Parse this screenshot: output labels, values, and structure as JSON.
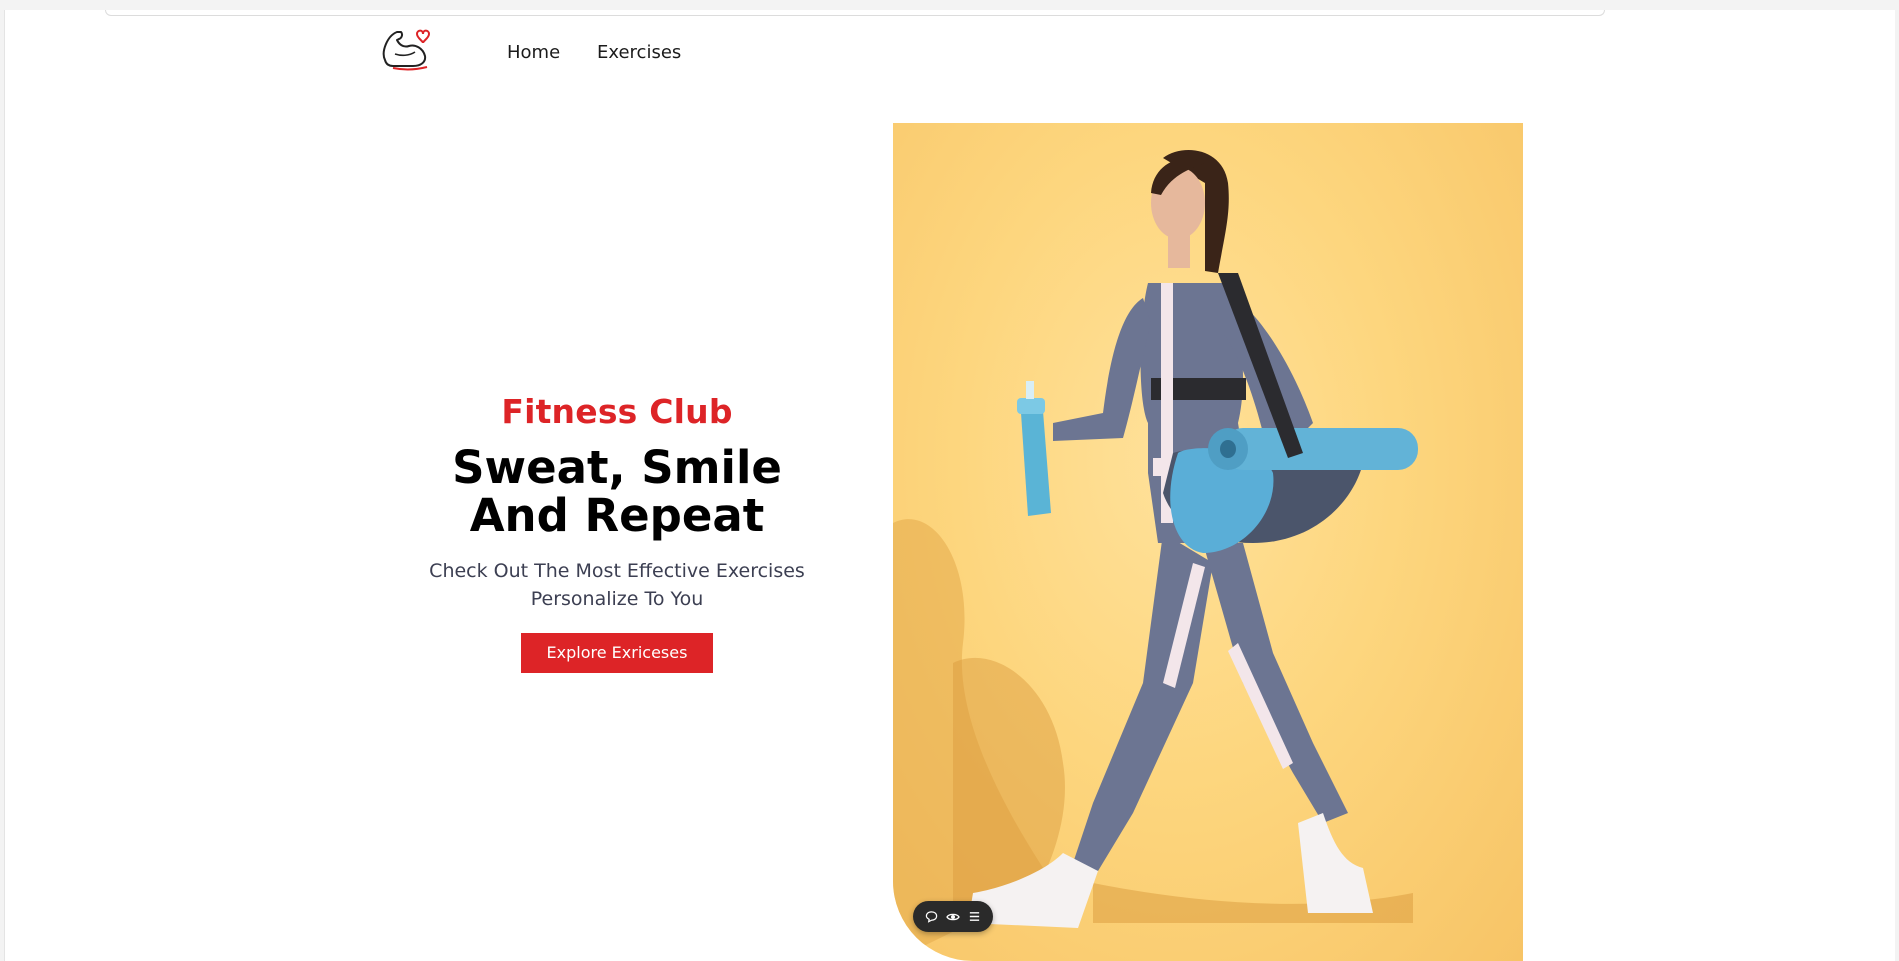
{
  "nav": {
    "home_label": "Home",
    "exercises_label": "Exercises",
    "logo_icon": "flexed-arm-heart-icon"
  },
  "hero": {
    "subtitle": "Fitness Club",
    "title_line1": "Sweat, Smile",
    "title_line2": "And Repeat",
    "description_line1": "Check Out The Most Effective Exercises",
    "description_line2": "Personalize To You",
    "button_label": "Explore Exriceses",
    "image_subject": "woman-walking-with-gym-bag-and-yoga-mat"
  },
  "toolbar": {
    "icons": [
      "comment-icon",
      "eye-icon",
      "menu-icon"
    ]
  },
  "colors": {
    "accent": "#dd2427",
    "title": "#000000",
    "description": "#3c3f52",
    "image_background": "#fdd67e"
  }
}
